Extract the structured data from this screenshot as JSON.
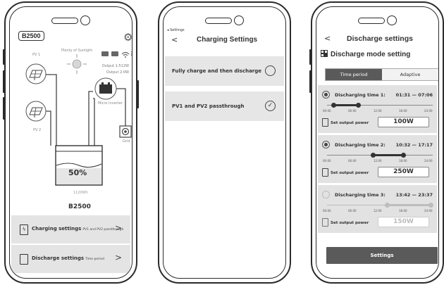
{
  "screen_home": {
    "model_badge": "B2500",
    "sunlight": "Plenty of Sunlight",
    "output_1": "Output 1:512W",
    "output_2": "Output 2:0W",
    "pv1": "PV 1",
    "pv2": "PV 2",
    "micro_inverter": "Micro Inverter",
    "grid": "Grid",
    "battery_percent": "50%",
    "battery_fill_fraction": 0.5,
    "capacity": "1120Wh",
    "model_name": "B2500",
    "charging_card": {
      "label": "Charging settings",
      "sub": "PV1 and PV2 passthrough"
    },
    "discharge_card": {
      "label": "Discharge settings",
      "sub": "Time period"
    }
  },
  "screen_charging": {
    "back_small": "◂ Settings",
    "back": "<",
    "title": "Charging Settings",
    "options": [
      {
        "label": "Fully charge and then discharge",
        "selected": false
      },
      {
        "label": "PV1 and PV2 passthrough",
        "selected": true
      }
    ]
  },
  "screen_discharge": {
    "back": "<",
    "title": "Discharge settings",
    "section_title": "Discharge mode setting",
    "tabs": {
      "active": "Time period",
      "inactive": "Adaptive"
    },
    "ticks": [
      "00:00",
      "06:00",
      "12:00",
      "18:00",
      "24:00"
    ],
    "power_label": "Set output power",
    "periods": [
      {
        "label": "Discharging time 1:",
        "start": "01:31",
        "end": "07:06",
        "power": "100W",
        "enabled": true
      },
      {
        "label": "Discharging time 2:",
        "start": "10:32",
        "end": "17:17",
        "power": "250W",
        "enabled": true
      },
      {
        "label": "Discharging time 3:",
        "start": "13:42",
        "end": "23:37",
        "power": "150W",
        "enabled": false
      }
    ],
    "settings_button": "Settings"
  }
}
